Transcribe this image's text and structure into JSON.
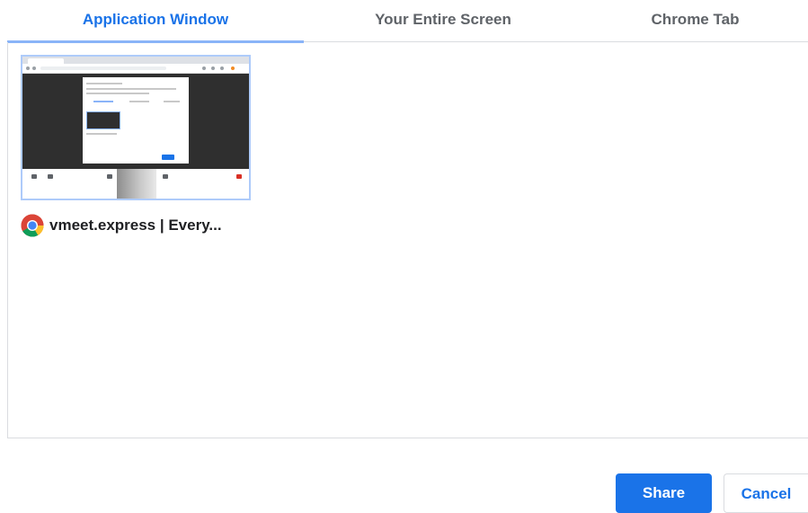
{
  "tabs": [
    {
      "label": "Application Window",
      "selected": true
    },
    {
      "label": "Your Entire Screen",
      "selected": false
    },
    {
      "label": "Chrome Tab",
      "selected": false
    }
  ],
  "sources": [
    {
      "title": "vmeet.express | Every...",
      "icon": "chrome-icon"
    }
  ],
  "buttons": {
    "share": "Share",
    "cancel": "Cancel"
  },
  "colors": {
    "accent": "#1a73e8",
    "tab_indicator": "#8ab4f8",
    "thumb_border": "#aecbfa",
    "divider": "#dadce0"
  }
}
